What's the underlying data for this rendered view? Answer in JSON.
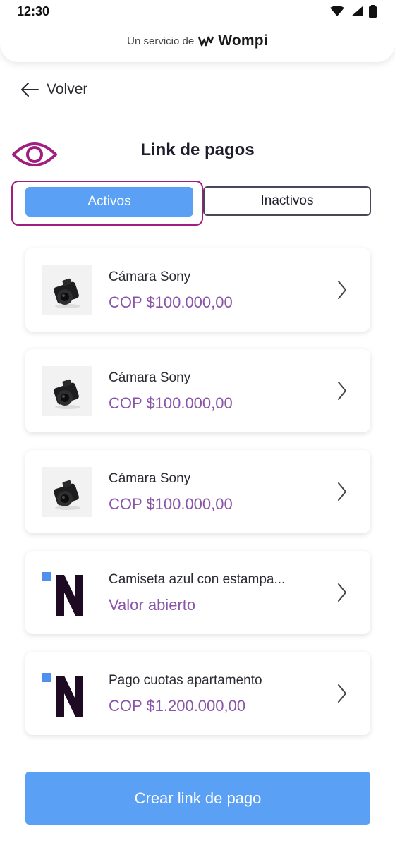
{
  "status_bar": {
    "time": "12:30"
  },
  "header": {
    "service_prefix": "Un servicio de",
    "brand": "Wompi"
  },
  "back": {
    "label": "Volver"
  },
  "page": {
    "title": "Link de pagos"
  },
  "tabs": [
    {
      "label": "Activos",
      "active": true
    },
    {
      "label": "Inactivos",
      "active": false
    }
  ],
  "links": [
    {
      "name": "Cámara Sony",
      "price": "COP $100.000,00",
      "thumbnail": "camera-image"
    },
    {
      "name": "Cámara Sony",
      "price": "COP $100.000,00",
      "thumbnail": "camera-image"
    },
    {
      "name": "Cámara Sony",
      "price": "COP $100.000,00",
      "thumbnail": "camera-image"
    },
    {
      "name": "Camiseta azul con estampa...",
      "price": "Valor abierto",
      "thumbnail": "n-logo"
    },
    {
      "name": "Pago cuotas apartamento",
      "price": "COP $1.200.000,00",
      "thumbnail": "n-logo"
    }
  ],
  "actions": {
    "create_label": "Crear link de pago"
  },
  "colors": {
    "primary": "#5aa0f5",
    "price": "#8a55a8",
    "highlight": "#a01e7f",
    "logo_dark": "#1e0a22"
  }
}
